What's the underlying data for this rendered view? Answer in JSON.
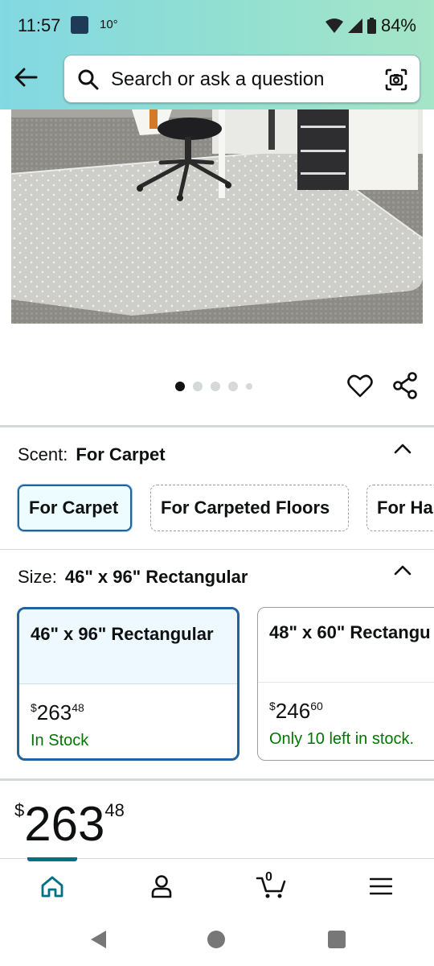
{
  "status_bar": {
    "time": "11:57",
    "temperature": "10°",
    "battery": "84%"
  },
  "search": {
    "placeholder": "Search or ask a question"
  },
  "carousel": {
    "image_count": 5,
    "active_index": 0
  },
  "scent": {
    "label": "Scent:",
    "selected": "For Carpet",
    "options": [
      "For Carpet",
      "For Carpeted Floors",
      "For Ha"
    ]
  },
  "size": {
    "label": "Size:",
    "selected": "46\" x 96\" Rectangular",
    "options": [
      {
        "name": "46\" x 96\" Rectangular",
        "price_currency": "$",
        "price_whole": "263",
        "price_fraction": "48",
        "stock": "In Stock"
      },
      {
        "name": "48\" x 60\" Rectangu",
        "price_currency": "$",
        "price_whole": "246",
        "price_fraction": "60",
        "stock": "Only 10 left in stock."
      }
    ]
  },
  "price": {
    "currency": "$",
    "whole": "263",
    "fraction": "48"
  },
  "bottom_nav": {
    "cart_count": "0"
  },
  "colors": {
    "accent": "#007185",
    "selected_border": "#2162a1",
    "in_stock": "#007600"
  }
}
